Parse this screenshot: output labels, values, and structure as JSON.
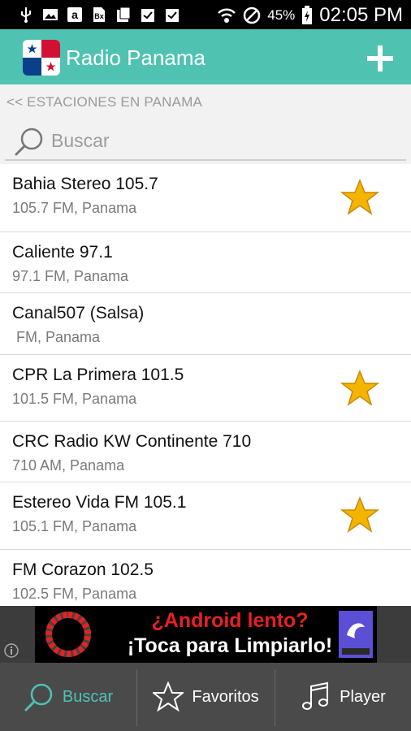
{
  "status_bar": {
    "battery": "45%",
    "time": "02:05 PM",
    "icons": [
      "usb-icon",
      "image-icon",
      "amazon-icon",
      "bx-icon",
      "clipboard-icon",
      "clipboard-check-icon",
      "clipboard-check-icon",
      "wifi-icon",
      "blocked-icon",
      "battery-icon"
    ]
  },
  "app_bar": {
    "title": "Radio Panama",
    "flag_icon": "panama-flag-icon",
    "add_icon": "plus-icon",
    "color": "#4fc2b2"
  },
  "section_label": "<< ESTACIONES EN PANAMA",
  "search": {
    "placeholder": "Buscar",
    "value": ""
  },
  "stations": [
    {
      "name": "Bahia Stereo 105.7",
      "sub": "105.7 FM, Panama",
      "favorite": true
    },
    {
      "name": "Caliente 97.1",
      "sub": "97.1 FM, Panama",
      "favorite": false
    },
    {
      "name": "Canal507 (Salsa)",
      "sub": " FM, Panama",
      "favorite": false
    },
    {
      "name": "CPR La Primera 101.5",
      "sub": "101.5 FM, Panama",
      "favorite": true
    },
    {
      "name": "CRC Radio KW Continente 710",
      "sub": "710 AM, Panama",
      "favorite": false
    },
    {
      "name": "Estereo Vida FM 105.1",
      "sub": "105.1 FM, Panama",
      "favorite": true
    },
    {
      "name": "FM Corazon 102.5",
      "sub": "102.5 FM, Panama",
      "favorite": false
    }
  ],
  "ad": {
    "line1": "¿Android lento?",
    "line2": "¡Toca para Limpiarlo!"
  },
  "tabs": [
    {
      "label": "Buscar",
      "icon": "search-icon",
      "active": true
    },
    {
      "label": "Favoritos",
      "icon": "star-outline-icon",
      "active": false
    },
    {
      "label": "Player",
      "icon": "music-note-icon",
      "active": false
    }
  ],
  "colors": {
    "accent": "#4fc2b2",
    "star": "#f5b400",
    "tab_active": "#4fc2b2",
    "tab_inactive": "#ffffff"
  }
}
